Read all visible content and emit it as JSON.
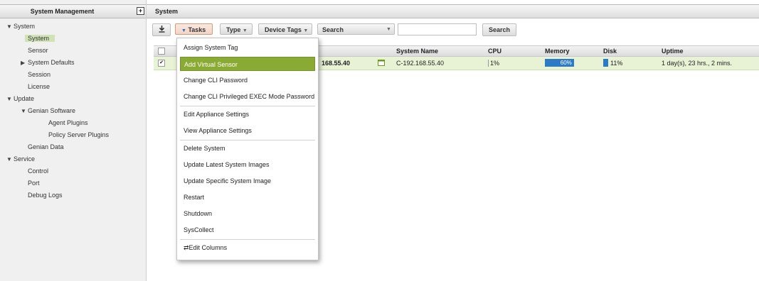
{
  "sidebar": {
    "title": "System Management",
    "expand_glyph": "+",
    "items": [
      {
        "label": "System",
        "caret": "▼"
      },
      {
        "label": "System",
        "selected": true
      },
      {
        "label": "Sensor"
      },
      {
        "label": "System Defaults",
        "caret": "▶"
      },
      {
        "label": "Session"
      },
      {
        "label": "License"
      },
      {
        "label": "Update",
        "caret": "▼"
      },
      {
        "label": "Genian Software",
        "caret": "▼"
      },
      {
        "label": "Agent Plugins"
      },
      {
        "label": "Policy Server Plugins"
      },
      {
        "label": "Genian Data"
      },
      {
        "label": "Service",
        "caret": "▼"
      },
      {
        "label": "Control"
      },
      {
        "label": "Port"
      },
      {
        "label": "Debug Logs"
      }
    ]
  },
  "main": {
    "title": "System"
  },
  "toolbar": {
    "download_icon": "download-icon",
    "tasks_label": "Tasks",
    "type_label": "Type",
    "device_tags_label": "Device Tags",
    "search_field_label": "Search",
    "search_input_value": "",
    "search_button": "Search",
    "dropdown_glyph": "▼"
  },
  "grid": {
    "columns": [
      "System Name",
      "CPU",
      "Memory",
      "Disk",
      "Uptime"
    ],
    "row": {
      "checked": "✔",
      "ip_partial": "168.55.40",
      "system_name": "C-192.168.55.40",
      "cpu": "1%",
      "memory": "60%",
      "memory_fraction": 0.6,
      "disk": "11%",
      "disk_fraction": 0.11,
      "uptime": "1 day(s), 23 hrs., 2 mins."
    }
  },
  "menu": {
    "items": [
      "Assign System Tag",
      "Add Virtual Sensor",
      "Change CLI Password",
      "Change CLI Privileged EXEC Mode Password",
      "Edit Appliance Settings",
      "View Appliance Settings",
      "Delete System",
      "Update Latest System Images",
      "Update Specific System Image",
      "Restart",
      "Shutdown",
      "SysCollect",
      "Edit Columns"
    ],
    "highlighted_index": 1,
    "edit_columns_glyph": "⇄"
  },
  "colors": {
    "highlight": "#8aab33",
    "selected_row": "#e8f2d4",
    "memory_bar": "#2d7bc4",
    "disk_bar": "#2d7bc4"
  }
}
